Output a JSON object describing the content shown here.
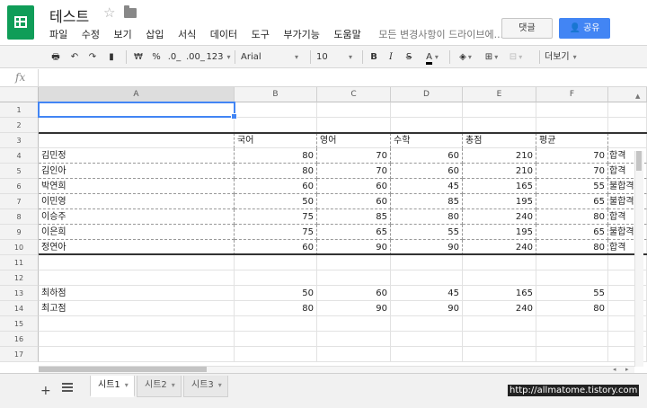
{
  "header": {
    "title": "테스트",
    "menu": [
      "파일",
      "수정",
      "보기",
      "삽입",
      "서식",
      "데이터",
      "도구",
      "부가기능",
      "도움말"
    ],
    "save_status": "모든 변경사항이 드라이브에...",
    "comment_label": "댓글",
    "share_label": "공유"
  },
  "toolbar": {
    "currency": "₩",
    "percent": "%",
    "dec_less": ".0_",
    "dec_more": ".00_",
    "format_more": "123",
    "font": "Arial",
    "font_size": "10",
    "bold": "B",
    "italic": "I",
    "strike": "S",
    "text_color": "A",
    "more": "더보기"
  },
  "formula_bar": {
    "fx": "fx",
    "value": ""
  },
  "columns": [
    "A",
    "B",
    "C",
    "D",
    "E",
    "F"
  ],
  "rows": [
    "1",
    "2",
    "3",
    "4",
    "5",
    "6",
    "7",
    "8",
    "9",
    "10",
    "11",
    "12",
    "13",
    "14",
    "15",
    "16",
    "17"
  ],
  "headers_row3": [
    "국어",
    "영어",
    "수학",
    "총점",
    "평균"
  ],
  "students": [
    {
      "name": "김민정",
      "kor": "80",
      "eng": "70",
      "math": "60",
      "total": "210",
      "avg": "70",
      "result": "합격"
    },
    {
      "name": "김인아",
      "kor": "80",
      "eng": "70",
      "math": "60",
      "total": "210",
      "avg": "70",
      "result": "합격"
    },
    {
      "name": "박연희",
      "kor": "60",
      "eng": "60",
      "math": "45",
      "total": "165",
      "avg": "55",
      "result": "불합격"
    },
    {
      "name": "이민영",
      "kor": "50",
      "eng": "60",
      "math": "85",
      "total": "195",
      "avg": "65",
      "result": "불합격"
    },
    {
      "name": "이승주",
      "kor": "75",
      "eng": "85",
      "math": "80",
      "total": "240",
      "avg": "80",
      "result": "합격"
    },
    {
      "name": "이은희",
      "kor": "75",
      "eng": "65",
      "math": "55",
      "total": "195",
      "avg": "65",
      "result": "불합격"
    },
    {
      "name": "정연아",
      "kor": "60",
      "eng": "90",
      "math": "90",
      "total": "240",
      "avg": "80",
      "result": "합격"
    }
  ],
  "summary": [
    {
      "label": "최하점",
      "kor": "50",
      "eng": "60",
      "math": "45",
      "total": "165",
      "avg": "55"
    },
    {
      "label": "최고점",
      "kor": "80",
      "eng": "90",
      "math": "90",
      "total": "240",
      "avg": "80"
    }
  ],
  "sheets": [
    "시트1",
    "시트2",
    "시트3"
  ],
  "watermark": "http://allmatome.tistory.com"
}
